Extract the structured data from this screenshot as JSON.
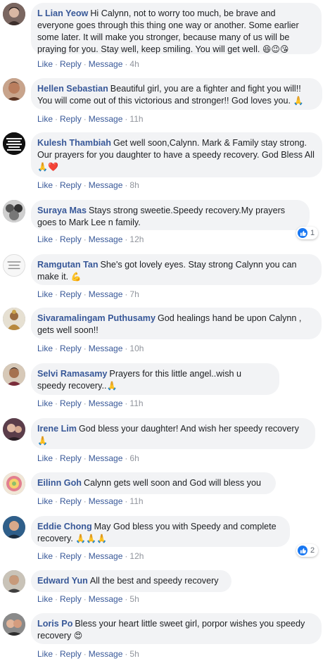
{
  "colors": {
    "name_blue": "#385898",
    "bubble_bg": "#f2f3f5",
    "meta_gray": "#90949c",
    "like_blue": "#1877f2"
  },
  "actions": {
    "like": "Like",
    "reply": "Reply",
    "message": "Message",
    "separator": "·"
  },
  "comments": [
    {
      "author": "L Lian Yeow",
      "text": "Hi Calynn, not to worry too much, be brave and everyone goes through this thing one way or another. Some earlier some later. It will make you stronger, because many of us will be praying for you. Stay well, keep smiling. You will get well.",
      "emoji": "😆😉😘",
      "time": "4h"
    },
    {
      "author": "Hellen Sebastian",
      "text": "Beautiful girl, you are a fighter and fight you will!! You will come out of this victorious and stronger!! God loves you.",
      "emoji": "🙏",
      "time": "11h"
    },
    {
      "author": "Kulesh Thambiah",
      "text": "Get well soon,Calynn. Mark & Family stay strong. Our prayers for you daughter to have a speedy recovery. God Bless All",
      "emoji": "🙏❤️",
      "time": "8h",
      "avatar_text": "A DEAD FLOWER SHINES BRIGHTER THAN THAT OF A GOOD HEART"
    },
    {
      "author": "Suraya Mas",
      "text": "Stays strong sweetie.Speedy recovery.My prayers goes to Mark Lee n family.",
      "emoji": "",
      "time": "12h",
      "reactions": "1"
    },
    {
      "author": "Ramgutan Tan",
      "text": "She's got lovely eyes. Stay strong Calynn you can make it.",
      "emoji": "💪",
      "time": "7h",
      "avatar_text": "live your life and forget your age"
    },
    {
      "author": "Sivaramalingam Puthusamy",
      "text": "God healings hand be upon Calynn , gets well soon!!",
      "emoji": "",
      "time": "10h"
    },
    {
      "author": "Selvi Ramasamy",
      "text": "Prayers for this little angel..wish u speedy recovery..",
      "emoji": "🙏",
      "time": "11h"
    },
    {
      "author": "Irene Lim",
      "text": "God bless your daughter! And wish her speedy recovery",
      "emoji": "🙏",
      "time": "6h"
    },
    {
      "author": "Eilinn Goh",
      "text": "Calynn gets well soon and God will bless you",
      "emoji": "",
      "time": "11h"
    },
    {
      "author": "Eddie Chong",
      "text": "May God bless you with Speedy and complete recovery.",
      "emoji": "🙏🙏🙏",
      "time": "12h",
      "reactions": "2"
    },
    {
      "author": "Edward Yun",
      "text": "All the best and speedy recovery",
      "emoji": "",
      "time": "5h"
    },
    {
      "author": "Loris Po",
      "text": "Bless your heart little sweet girl, porpor wishes you speedy recovery",
      "emoji": "😍",
      "time": "5h"
    }
  ]
}
